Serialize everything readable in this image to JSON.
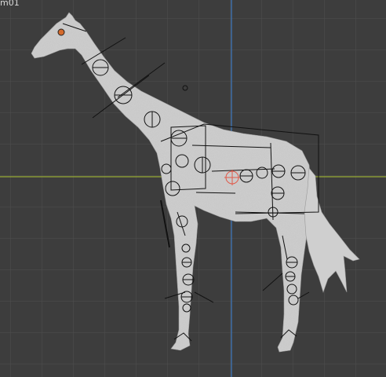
{
  "viewport": {
    "object_label": "m01",
    "background": "#3d3d3d",
    "grid_color": "#4f4f4f",
    "x_axis_color": "#8a9a36",
    "y_axis_color": "#3f6fa8",
    "subject": "giraffe-mesh-with-rig",
    "mesh_color": "#c9c9c9",
    "rig_color": "#111111",
    "selected_bone_color": "#e05a4a"
  }
}
